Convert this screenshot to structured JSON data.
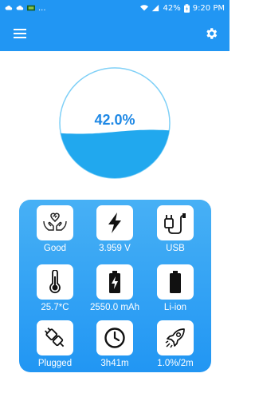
{
  "status_bar": {
    "left_icons": [
      "cloud-icon",
      "cloud-icon",
      "notification-app-icon"
    ],
    "ellipsis": "...",
    "battery_percent": "42%",
    "time": "9:20 PM"
  },
  "app_bar": {
    "menu_icon": "hamburger-menu-icon",
    "settings_icon": "gear-icon"
  },
  "gauge": {
    "label": "42.0%",
    "level": 0.42,
    "fill_color": "#21A8EE",
    "ring_color": "#7FD0F7"
  },
  "stats": [
    {
      "icon": "heart-hands-icon",
      "label": "Good"
    },
    {
      "icon": "lightning-bolt-icon",
      "label": "3.959 V"
    },
    {
      "icon": "usb-plug-icon",
      "label": "USB"
    },
    {
      "icon": "thermometer-icon",
      "label": "25.7*C"
    },
    {
      "icon": "battery-charging-icon",
      "label": "2550.0 mAh"
    },
    {
      "icon": "battery-full-icon",
      "label": "Li-ion"
    },
    {
      "icon": "plug-connector-icon",
      "label": "Plugged"
    },
    {
      "icon": "clock-icon",
      "label": "3h41m"
    },
    {
      "icon": "rocket-icon",
      "label": "1.0%/2m"
    }
  ],
  "colors": {
    "primary": "#2196F3",
    "panel_top": "#47B0F5",
    "panel_bottom": "#2196F3",
    "gauge_text": "#1E88E5"
  }
}
